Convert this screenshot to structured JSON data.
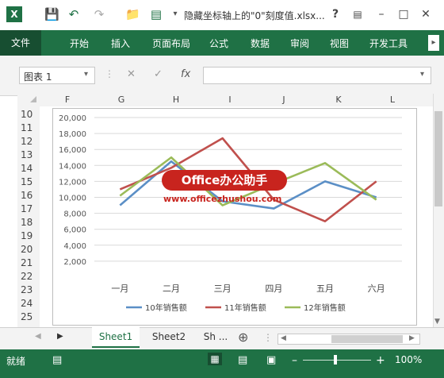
{
  "title_bar": {
    "app_icon": "X",
    "doc_title": "隐藏坐标轴上的\"0\"刻度值.xlsx...",
    "help": "?",
    "window_buttons": [
      "–",
      "□",
      "✕"
    ]
  },
  "ribbon": {
    "tabs": [
      "文件",
      "开始",
      "插入",
      "页面布局",
      "公式",
      "数据",
      "审阅",
      "视图",
      "开发工具"
    ]
  },
  "formula_bar": {
    "name_box": "图表 1",
    "cancel": "✕",
    "enter": "✓",
    "fx": "fx",
    "value": ""
  },
  "grid": {
    "columns": [
      "F",
      "G",
      "H",
      "I",
      "J",
      "K",
      "L"
    ],
    "rows": [
      "10",
      "11",
      "12",
      "13",
      "14",
      "15",
      "16",
      "17",
      "18",
      "19",
      "20",
      "21",
      "22",
      "23",
      "24",
      "25"
    ]
  },
  "watermark": {
    "badge": "Office办公助手",
    "url": "www.officezhushou.com"
  },
  "chart_data": {
    "type": "line",
    "categories": [
      "一月",
      "二月",
      "三月",
      "四月",
      "五月",
      "六月"
    ],
    "ylim": [
      0,
      20000
    ],
    "yticks": [
      "20,000",
      "18,000",
      "16,000",
      "14,000",
      "12,000",
      "10,000",
      "8,000",
      "6,000",
      "4,000",
      "2,000"
    ],
    "grid": true,
    "legend_position": "bottom",
    "series": [
      {
        "name": "10年销售额",
        "color": "#5b8fc6",
        "values": [
          9000,
          14500,
          9500,
          8600,
          12000,
          10000
        ]
      },
      {
        "name": "11年销售额",
        "color": "#c0504d",
        "values": [
          11000,
          13700,
          17400,
          9700,
          7000,
          12000
        ]
      },
      {
        "name": "12年销售额",
        "color": "#9bbb59",
        "values": [
          10200,
          15000,
          9000,
          11700,
          14300,
          9700
        ]
      }
    ]
  },
  "sheets": {
    "tabs": [
      "Sheet1",
      "Sheet2",
      "Sh ..."
    ],
    "active": "Sheet1",
    "add": "⊕"
  },
  "status_bar": {
    "mode": "就绪",
    "zoom": "100%",
    "zoom_minus": "–",
    "zoom_plus": "+"
  }
}
